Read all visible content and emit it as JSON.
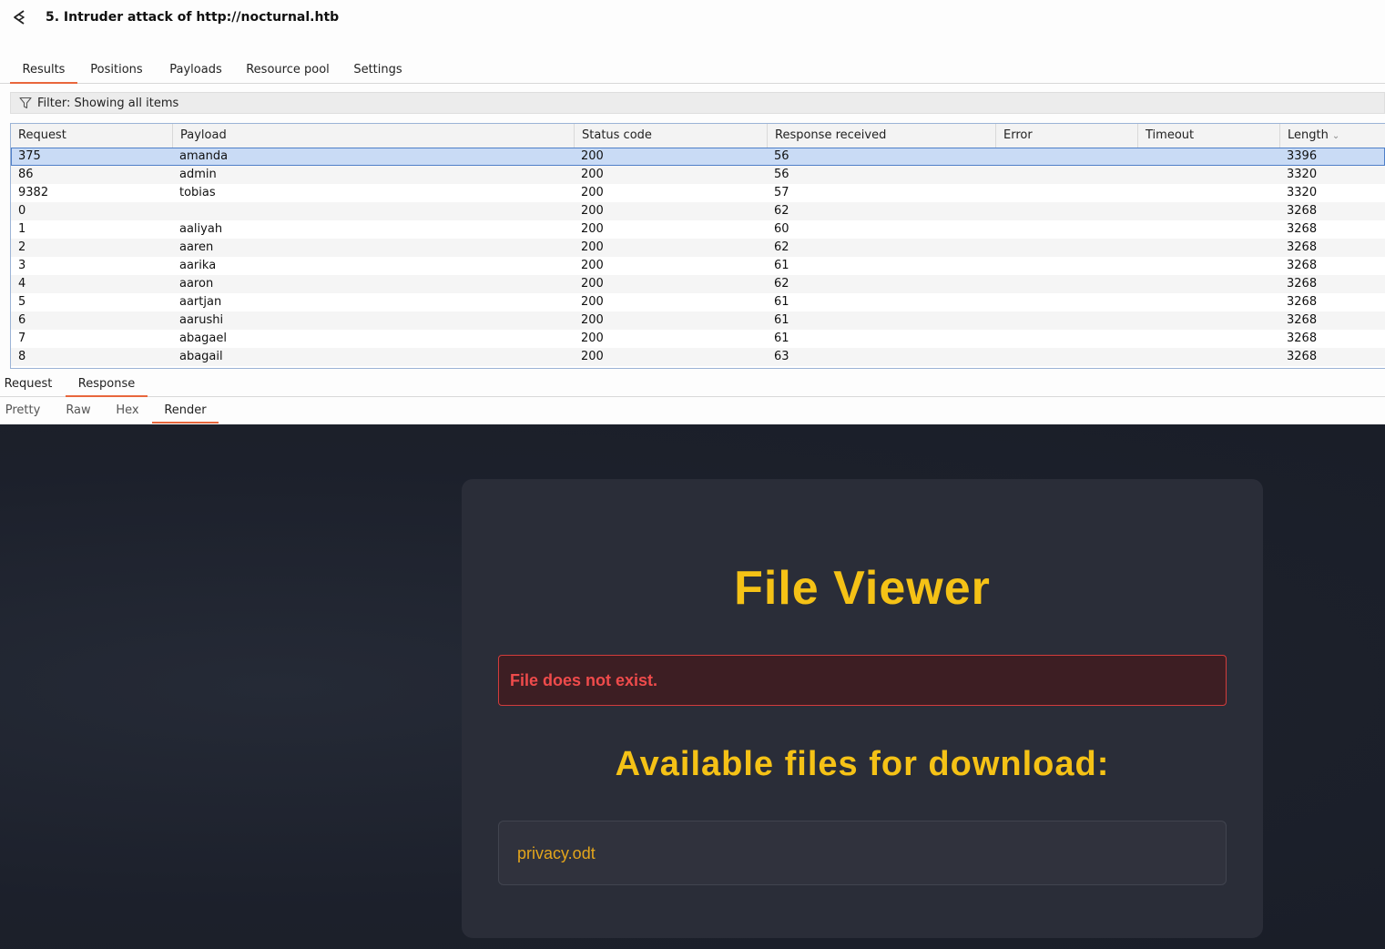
{
  "window": {
    "title": "5. Intruder attack of http://nocturnal.htb"
  },
  "tabs": [
    "Results",
    "Positions",
    "Payloads",
    "Resource pool",
    "Settings"
  ],
  "filter": {
    "label": "Filter: Showing all items"
  },
  "table": {
    "columns": [
      "Request",
      "Payload",
      "Status code",
      "Response received",
      "Error",
      "Timeout",
      "Length"
    ],
    "rows": [
      [
        "375",
        "amanda",
        "200",
        "56",
        "",
        "",
        "3396"
      ],
      [
        "86",
        "admin",
        "200",
        "56",
        "",
        "",
        "3320"
      ],
      [
        "9382",
        "tobias",
        "200",
        "57",
        "",
        "",
        "3320"
      ],
      [
        "0",
        "",
        "200",
        "62",
        "",
        "",
        "3268"
      ],
      [
        "1",
        "aaliyah",
        "200",
        "60",
        "",
        "",
        "3268"
      ],
      [
        "2",
        "aaren",
        "200",
        "62",
        "",
        "",
        "3268"
      ],
      [
        "3",
        "aarika",
        "200",
        "61",
        "",
        "",
        "3268"
      ],
      [
        "4",
        "aaron",
        "200",
        "62",
        "",
        "",
        "3268"
      ],
      [
        "5",
        "aartjan",
        "200",
        "61",
        "",
        "",
        "3268"
      ],
      [
        "6",
        "aarushi",
        "200",
        "61",
        "",
        "",
        "3268"
      ],
      [
        "7",
        "abagael",
        "200",
        "61",
        "",
        "",
        "3268"
      ],
      [
        "8",
        "abagail",
        "200",
        "63",
        "",
        "",
        "3268"
      ]
    ]
  },
  "message_tabs": [
    "Request",
    "Response"
  ],
  "view_tabs": [
    "Pretty",
    "Raw",
    "Hex",
    "Render"
  ],
  "render": {
    "title": "File Viewer",
    "error": "File does not exist.",
    "subtitle": "Available files for download:",
    "file": "privacy.odt"
  },
  "colors": {
    "accent": "#e8663c",
    "yellow": "#f5c216",
    "error": "#ef4b4b",
    "link": "#e3a51c",
    "selection": "#c9dbf5"
  }
}
